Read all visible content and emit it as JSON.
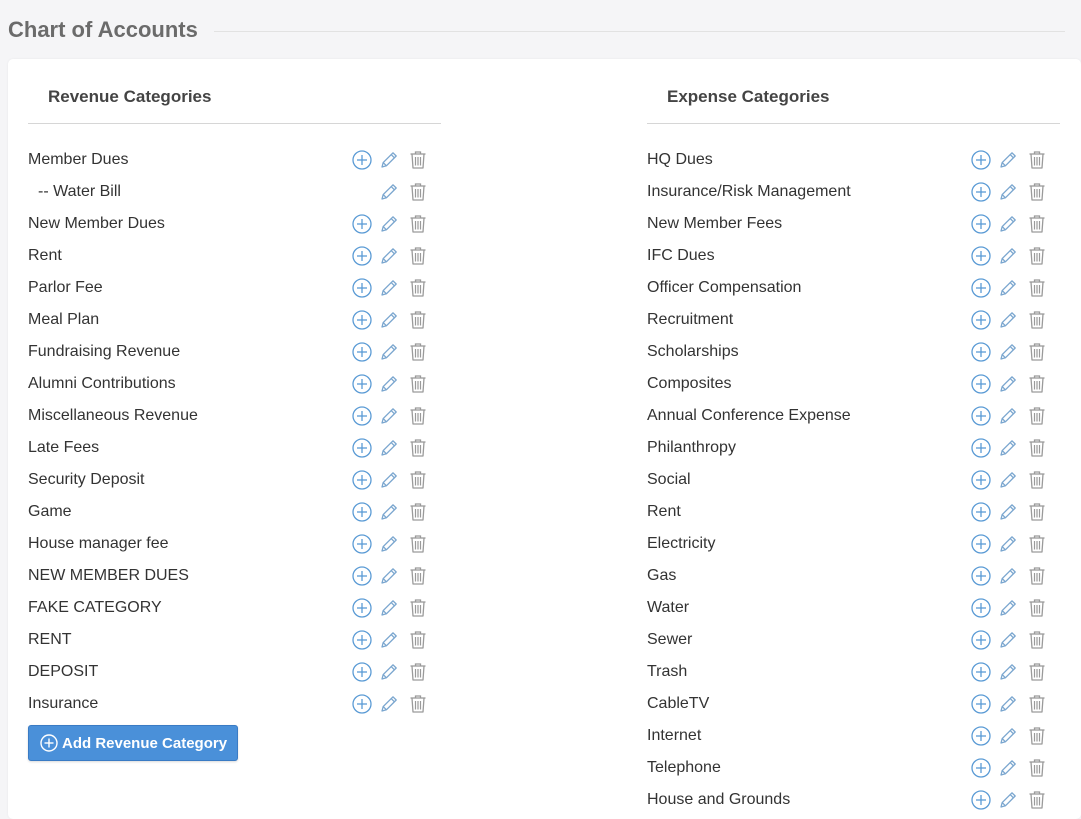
{
  "page": {
    "title": "Chart of Accounts"
  },
  "revenue": {
    "header": "Revenue Categories",
    "add_button_label": "Add Revenue Category",
    "items": [
      {
        "label": "Member Dues",
        "child": false,
        "can_add": true
      },
      {
        "label": "-- Water Bill",
        "child": true,
        "can_add": false
      },
      {
        "label": "New Member Dues",
        "child": false,
        "can_add": true
      },
      {
        "label": "Rent",
        "child": false,
        "can_add": true
      },
      {
        "label": "Parlor Fee",
        "child": false,
        "can_add": true
      },
      {
        "label": "Meal Plan",
        "child": false,
        "can_add": true
      },
      {
        "label": "Fundraising Revenue",
        "child": false,
        "can_add": true
      },
      {
        "label": "Alumni Contributions",
        "child": false,
        "can_add": true
      },
      {
        "label": "Miscellaneous Revenue",
        "child": false,
        "can_add": true
      },
      {
        "label": "Late Fees",
        "child": false,
        "can_add": true
      },
      {
        "label": "Security Deposit",
        "child": false,
        "can_add": true
      },
      {
        "label": "Game",
        "child": false,
        "can_add": true
      },
      {
        "label": "House manager fee",
        "child": false,
        "can_add": true
      },
      {
        "label": "NEW MEMBER DUES",
        "child": false,
        "can_add": true
      },
      {
        "label": "FAKE CATEGORY",
        "child": false,
        "can_add": true
      },
      {
        "label": "RENT",
        "child": false,
        "can_add": true
      },
      {
        "label": "DEPOSIT",
        "child": false,
        "can_add": true
      },
      {
        "label": "Insurance",
        "child": false,
        "can_add": true
      }
    ]
  },
  "expense": {
    "header": "Expense Categories",
    "items": [
      {
        "label": "HQ Dues",
        "child": false,
        "can_add": true
      },
      {
        "label": "Insurance/Risk Management",
        "child": false,
        "can_add": true
      },
      {
        "label": "New Member Fees",
        "child": false,
        "can_add": true
      },
      {
        "label": "IFC Dues",
        "child": false,
        "can_add": true
      },
      {
        "label": "Officer Compensation",
        "child": false,
        "can_add": true
      },
      {
        "label": "Recruitment",
        "child": false,
        "can_add": true
      },
      {
        "label": "Scholarships",
        "child": false,
        "can_add": true
      },
      {
        "label": "Composites",
        "child": false,
        "can_add": true
      },
      {
        "label": "Annual Conference Expense",
        "child": false,
        "can_add": true
      },
      {
        "label": "Philanthropy",
        "child": false,
        "can_add": true
      },
      {
        "label": "Social",
        "child": false,
        "can_add": true
      },
      {
        "label": "Rent",
        "child": false,
        "can_add": true
      },
      {
        "label": "Electricity",
        "child": false,
        "can_add": true
      },
      {
        "label": "Gas",
        "child": false,
        "can_add": true
      },
      {
        "label": "Water",
        "child": false,
        "can_add": true
      },
      {
        "label": "Sewer",
        "child": false,
        "can_add": true
      },
      {
        "label": "Trash",
        "child": false,
        "can_add": true
      },
      {
        "label": "CableTV",
        "child": false,
        "can_add": true
      },
      {
        "label": "Internet",
        "child": false,
        "can_add": true
      },
      {
        "label": "Telephone",
        "child": false,
        "can_add": true
      },
      {
        "label": "House and Grounds",
        "child": false,
        "can_add": true
      }
    ]
  },
  "icons": {
    "add": "plus-circle-icon",
    "edit": "pencil-icon",
    "delete": "trash-icon"
  },
  "colors": {
    "accent": "#4a90d9",
    "icon_add": "#5b9bd5",
    "icon_edit": "#7aa6cf",
    "icon_delete": "#9a9a9a"
  }
}
